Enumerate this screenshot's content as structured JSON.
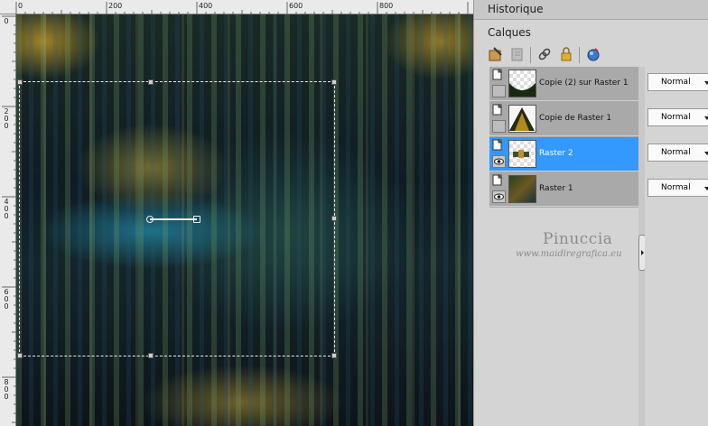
{
  "ruler": {
    "top_labels": [
      "0",
      "200",
      "400",
      "600",
      "800"
    ],
    "left_labels": [
      "0",
      "2\n0\n0",
      "4\n0\n0",
      "6\n0\n0",
      "8\n0\n0"
    ]
  },
  "canvas": {
    "description_icon": "image-canvas"
  },
  "panel": {
    "history_title": "Historique",
    "layers_title": "Calques",
    "toolbar_icons": [
      "new-raster-layer-icon",
      "new-mask-icon",
      "link-icon",
      "lock-icon",
      "layer-properties-icon"
    ],
    "layers": [
      {
        "name": "Copie (2) sur Raster 1",
        "blend": "Normal",
        "selected": false,
        "visible": false
      },
      {
        "name": "Copie de Raster 1",
        "blend": "Normal",
        "selected": false,
        "visible": false
      },
      {
        "name": "Raster 2",
        "blend": "Normal",
        "selected": true,
        "visible": true
      },
      {
        "name": "Raster 1",
        "blend": "Normal",
        "selected": false,
        "visible": true
      }
    ],
    "watermark": {
      "name": "Pinuccia",
      "url": "www.maidiregrafica.eu"
    }
  },
  "colors": {
    "selection_highlight": "#3399ff",
    "panel_bg": "#d4d4d4",
    "layer_bg": "#a9a9a9"
  }
}
